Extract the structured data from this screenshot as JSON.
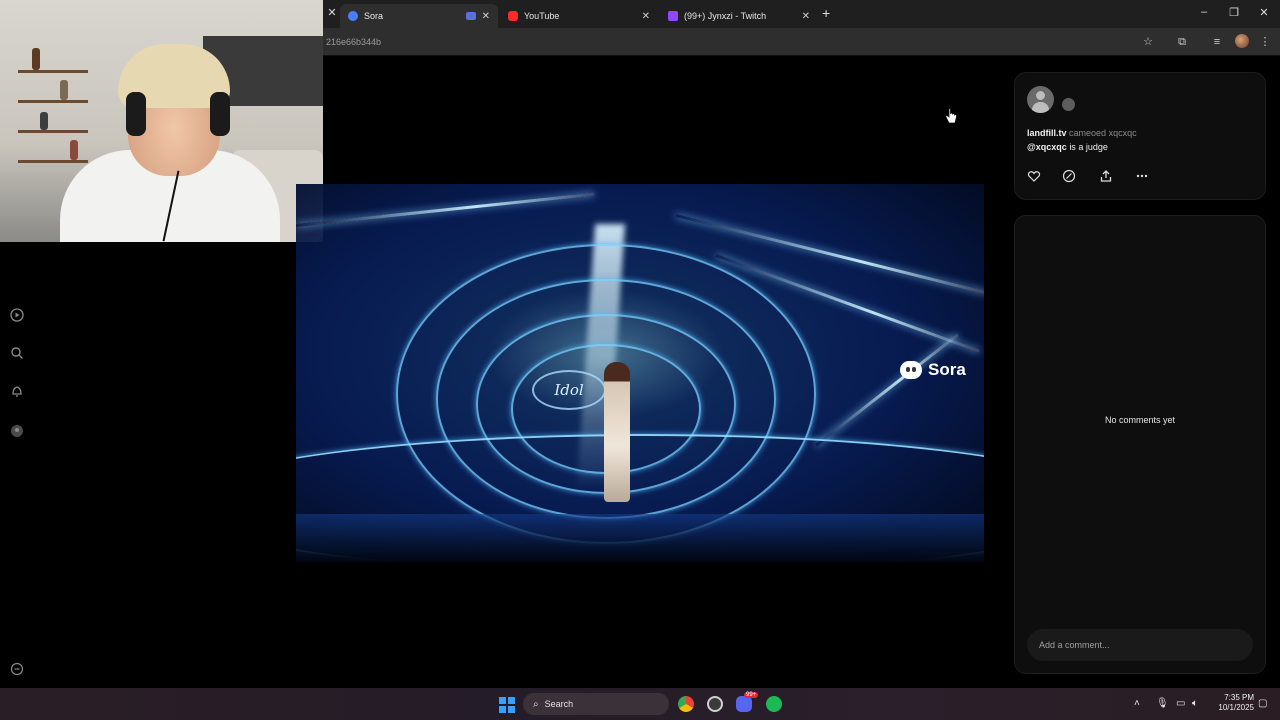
{
  "browser": {
    "tabs": [
      {
        "label": "Sora",
        "active": true
      },
      {
        "label": "YouTube",
        "active": false
      },
      {
        "label": "(99+) Jynxzi - Twitch",
        "active": false
      }
    ],
    "url": "216e66b344b"
  },
  "video": {
    "watermark": "Sora",
    "logo_text": "Idol"
  },
  "post": {
    "author": "landfill.tv",
    "verb": "cameoed",
    "cameo_user": "xqcxqc",
    "mention": "@xqcxqc",
    "caption_rest": "is a judge"
  },
  "comments": {
    "empty_text": "No comments yet",
    "input_placeholder": "Add a comment..."
  },
  "taskbar": {
    "search_label": "Search",
    "time": "7:35 PM",
    "date": "10/1/2025",
    "notification_badge": "99+"
  },
  "colors": {
    "accent_blue": "#3aa0ff",
    "panel_bg": "#0e0e0e",
    "stage_blue": "#1e5ac8"
  },
  "icons": [
    "play-icon",
    "search-icon",
    "bell-icon",
    "profile-icon",
    "more-icon",
    "heart-icon",
    "remix-icon",
    "share-icon",
    "ellipsis-icon"
  ]
}
